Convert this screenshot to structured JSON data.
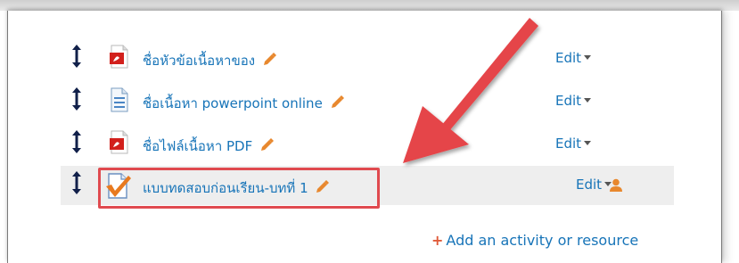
{
  "activities": [
    {
      "icon": "pdf-file-icon",
      "title": "ชื่อหัวข้อเนื้อหาของ",
      "edit_label": "Edit"
    },
    {
      "icon": "document-file-icon",
      "title": "ชื่อเนื้อหา powerpoint online",
      "edit_label": "Edit"
    },
    {
      "icon": "pdf-file-icon",
      "title": "ชื่อไฟล์เนื้อหา PDF",
      "edit_label": "Edit"
    },
    {
      "icon": "quiz-icon",
      "title": "แบบทดสอบก่อนเรียน-บทที่ 1",
      "edit_label": "Edit"
    }
  ],
  "add_activity_label": "Add an activity or resource",
  "colors": {
    "link": "#1774b8",
    "pencil": "#e8882e",
    "arrow": "#e54548",
    "highlight": "#eeeeee"
  }
}
